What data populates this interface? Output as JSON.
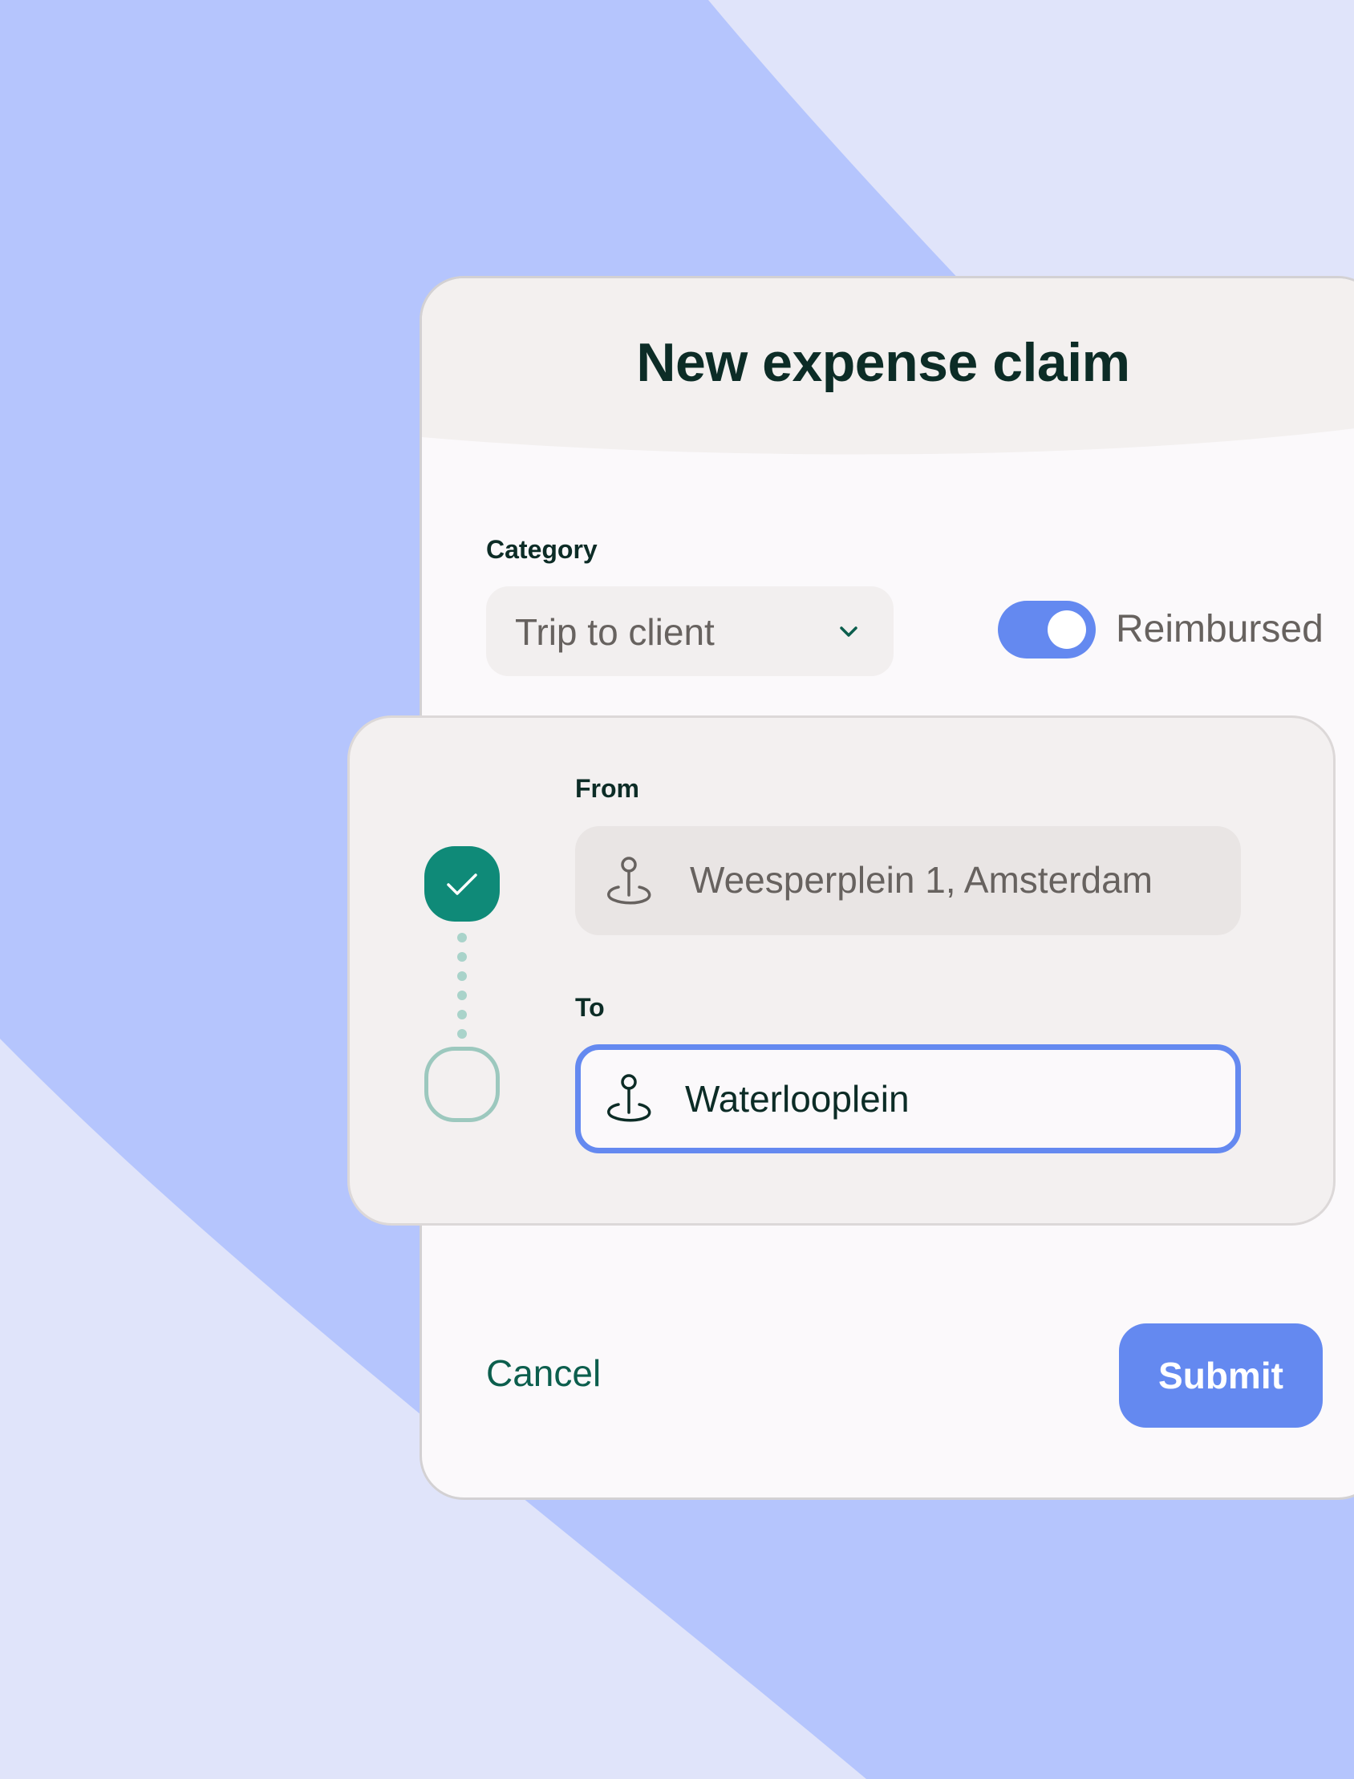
{
  "colors": {
    "background_light": "#e0e4fa",
    "background_band": "#b5c5fd",
    "accent": "#6489f0",
    "brand_green": "#0f8a78",
    "text_dark": "#0c2c26"
  },
  "dialog": {
    "title": "New expense claim",
    "category": {
      "label": "Category",
      "value": "Trip to client",
      "icon": "chevron-down-icon"
    },
    "reimbursed": {
      "label": "Reimbursed",
      "on": true
    },
    "route": {
      "from": {
        "label": "From",
        "value": "Weesperplein 1, Amsterdam",
        "icon": "location-pin-icon",
        "status": "completed",
        "status_icon": "check-icon"
      },
      "to": {
        "label": "To",
        "value": "Waterlooplein",
        "icon": "location-pin-icon",
        "status": "pending",
        "focused": true
      }
    },
    "actions": {
      "cancel_label": "Cancel",
      "submit_label": "Submit"
    }
  }
}
